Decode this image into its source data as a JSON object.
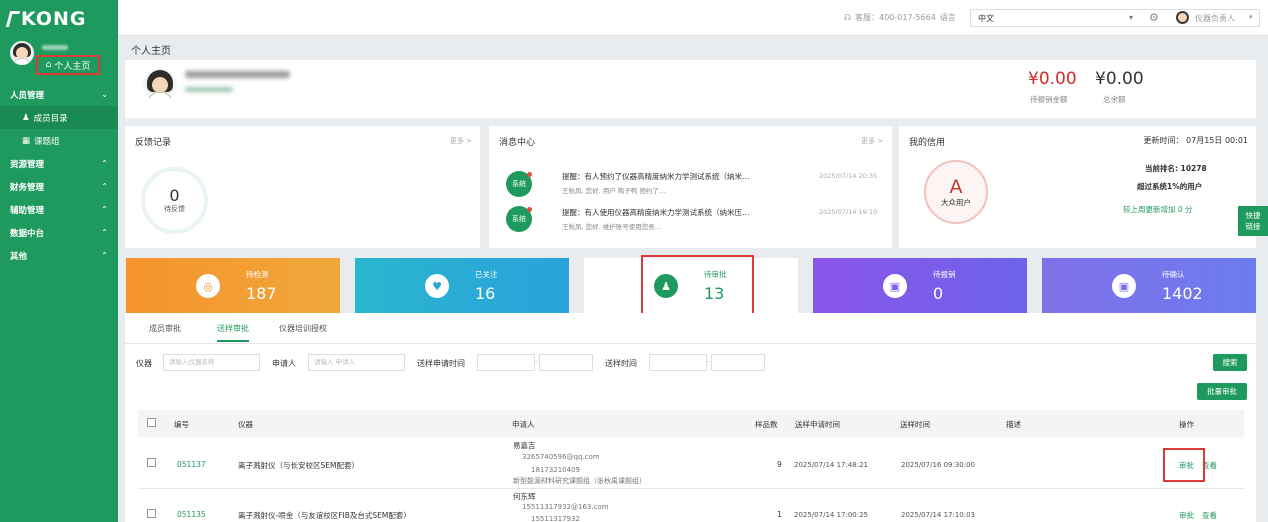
{
  "sidebar": {
    "logo": "KONG",
    "user_name": "",
    "home_label": "个人主页",
    "groups": [
      {
        "label": "人员管理",
        "chevron": "chevron-down"
      },
      {
        "label": "资源管理",
        "chevron": "chevron-up"
      },
      {
        "label": "财务管理",
        "chevron": "chevron-up"
      },
      {
        "label": "辅助管理",
        "chevron": "chevron-up"
      },
      {
        "label": "数据中台",
        "chevron": "chevron-up"
      },
      {
        "label": "其他",
        "chevron": "chevron-up"
      }
    ],
    "sub_items": [
      {
        "label": "成员目录",
        "icon": "user-icon"
      },
      {
        "label": "课题组",
        "icon": "grid-icon"
      }
    ]
  },
  "topbar": {
    "service": "客服：400-017-5664",
    "lang_label": "语言",
    "lang_value": "中文",
    "role": "仪器负责人"
  },
  "page_title": "个人主页",
  "profile": {
    "balance_pending": "¥0.00",
    "balance_pending_label": "待报销金额",
    "balance_total": "¥0.00",
    "balance_total_label": "总余额"
  },
  "feedback": {
    "title": "反馈记录",
    "more": "更多 >",
    "count": "0",
    "count_label": "待反馈"
  },
  "messages": {
    "title": "消息中心",
    "more": "更多 >",
    "items": [
      {
        "badge": "系统",
        "title": "提醒：有人预约了仪器高精度纳米力学测试系统（纳米…",
        "sub": "王秋凤, 您好. 用户 陶子鸭 预约了…",
        "time": "2025/07/14 20:35"
      },
      {
        "badge": "系统",
        "title": "提醒：有人使用仪器高精度纳米力学测试系统（纳米压…",
        "sub": "王秋凤, 您好. 维护账号使用您务…",
        "time": "2025/07/14 19:10"
      }
    ]
  },
  "credit": {
    "title": "我的信用",
    "updated": "更新时间： 07月15日 00:01",
    "grade": "A",
    "grade_label": "大众用户",
    "rank": "当前排名: 10278",
    "over": "超过系统1%的用户",
    "week": "较上周更新增加 0 分"
  },
  "quick_link": [
    "快捷",
    "链接"
  ],
  "stats": [
    {
      "label": "待检测",
      "value": "187",
      "icon": "target-icon",
      "color": "#f08c2e"
    },
    {
      "label": "已关注",
      "value": "16",
      "icon": "heart-icon",
      "color": "#27b3c8"
    },
    {
      "label": "待审批",
      "value": "13",
      "icon": "user-check-icon",
      "color": "#ffffff"
    },
    {
      "label": "待报销",
      "value": "0",
      "icon": "receipt-icon",
      "color": "#7c5ce6"
    },
    {
      "label": "待确认",
      "value": "1402",
      "icon": "clipboard-icon",
      "color": "#7a6fe8"
    }
  ],
  "tabs": [
    {
      "label": "成员审批",
      "active": false
    },
    {
      "label": "送样审批",
      "active": true
    },
    {
      "label": "仪器培训授权",
      "active": false
    }
  ],
  "filters": {
    "instrument_label": "仪器",
    "instrument_placeholder": "请输入仪器名称",
    "applicant_label": "申请人",
    "applicant_placeholder": "请输入 申请人",
    "apply_time_label": "送样申请时间",
    "send_time_label": "送样时间",
    "search_label": "搜索",
    "batch_label": "批量审批",
    "range_sep": "-"
  },
  "table": {
    "headers": [
      "编号",
      "仪器",
      "申请人",
      "样品数",
      "送样申请时间",
      "送样时间",
      "描述",
      "操作"
    ],
    "rows": [
      {
        "id": "051137",
        "instrument": "离子溅射仪（与长安校区SEM配套）",
        "applicant_name": "易嘉吉",
        "applicant_email": "3265740596@qq.com",
        "applicant_phone": "18173210409",
        "applicant_group": "新型能源材料研究课题组（张秋禹课题组）",
        "samples": "9",
        "apply_time": "2025/07/14 17:48:21",
        "send_time": "2025/07/16 09:30:00",
        "action_approve": "审批",
        "action_view": "查看"
      },
      {
        "id": "051135",
        "instrument": "离子溅射仪-喷金（与友谊校区FIB及台式SEM配套）",
        "applicant_name": "何东辉",
        "applicant_email": "15511317932@163.com",
        "applicant_phone": "15511317932",
        "samples": "1",
        "apply_time": "2025/07/14 17:00:25",
        "send_time": "2025/07/14 17:10:03",
        "action_approve": "审批",
        "action_view": "查看"
      }
    ]
  }
}
